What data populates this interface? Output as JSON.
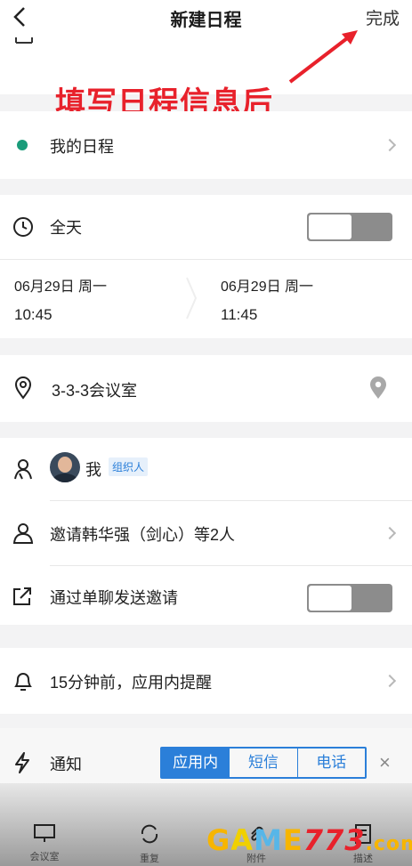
{
  "header": {
    "title": "新建日程",
    "done_label": "完成"
  },
  "annotation": {
    "text": "填写日程信息后",
    "color": "#e8212b"
  },
  "top_partial": {
    "text": ""
  },
  "calendar": {
    "label": "我的日程",
    "dot_color": "#1a9c7a"
  },
  "all_day": {
    "label": "全天",
    "on": false
  },
  "time": {
    "start_date": "06月29日 周一",
    "start_time": "10:45",
    "end_date": "06月29日 周一",
    "end_time": "11:45"
  },
  "location": {
    "text": "3-3-3会议室"
  },
  "organizer": {
    "name": "我",
    "tag": "组织人"
  },
  "invite": {
    "text": "邀请韩华强（剑心）等2人"
  },
  "send_invite": {
    "label": "通过单聊发送邀请",
    "on": false
  },
  "reminder": {
    "text": "15分钟前，应用内提醒"
  },
  "notify": {
    "label": "通知",
    "options": [
      "应用内",
      "短信",
      "电话"
    ],
    "active": "应用内",
    "close": "×"
  },
  "bottom_tabs": [
    "会议室",
    "重复",
    "附件",
    "描述"
  ],
  "watermark": {
    "g": "G",
    "a": "A",
    "m": "M",
    "e": "E",
    "num": "773",
    "dom": ".com"
  },
  "accent": "#2b7fd9"
}
